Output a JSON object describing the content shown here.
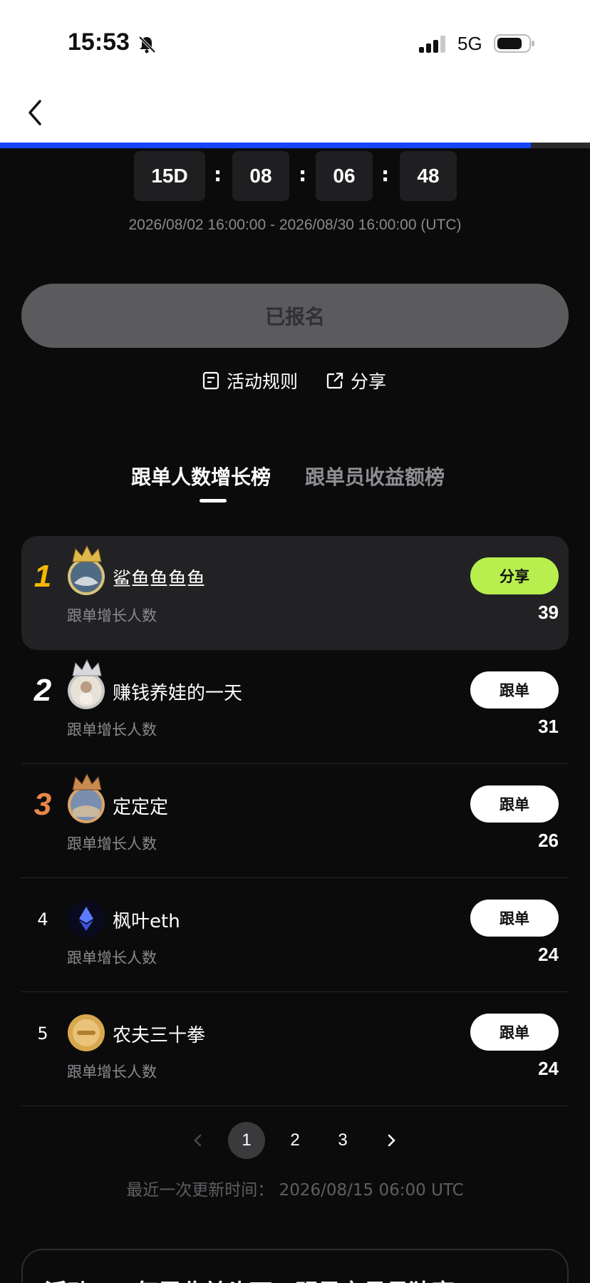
{
  "status_bar": {
    "time": "15:53",
    "network": "5G"
  },
  "progress": {
    "value": 0.9,
    "color": "#1744ff"
  },
  "countdown": {
    "days": "15D",
    "hours": "08",
    "minutes": "06",
    "seconds": "48",
    "separator": ":"
  },
  "event_range": "2026/08/02 16:00:00 - 2026/08/30 16:00:00 (UTC)",
  "register_button": "已报名",
  "links": {
    "rules": "活动规则",
    "share": "分享"
  },
  "tabs": [
    {
      "label": "跟单人数增长榜",
      "active": true
    },
    {
      "label": "跟单员收益额榜",
      "active": false
    }
  ],
  "leaderboard": [
    {
      "rank": "1",
      "name": "鲨鱼鱼鱼鱼",
      "metric": "跟单增长人数",
      "value": "39",
      "action": "分享",
      "rank_color": "#f5b800"
    },
    {
      "rank": "2",
      "name": "赚钱养娃的一天",
      "metric": "跟单增长人数",
      "value": "31",
      "action": "跟单",
      "rank_color": "#ffffff"
    },
    {
      "rank": "3",
      "name": "定定定",
      "metric": "跟单增长人数",
      "value": "26",
      "action": "跟单",
      "rank_color": "#e8874a"
    },
    {
      "rank": "4",
      "name": "枫叶eth",
      "metric": "跟单增长人数",
      "value": "24",
      "action": "跟单",
      "rank_color": "#ffffff"
    },
    {
      "rank": "5",
      "name": "农夫三十拳",
      "metric": "跟单增长人数",
      "value": "24",
      "action": "跟单",
      "rank_color": "#ffffff"
    }
  ],
  "pagination": {
    "pages": [
      "1",
      "2",
      "3"
    ],
    "current": "1"
  },
  "last_updated": "最近一次更新时间： 2026/08/15 06:00 UTC",
  "bottom_card_title": "活动一：每周收益头下，明星交易员独享"
}
